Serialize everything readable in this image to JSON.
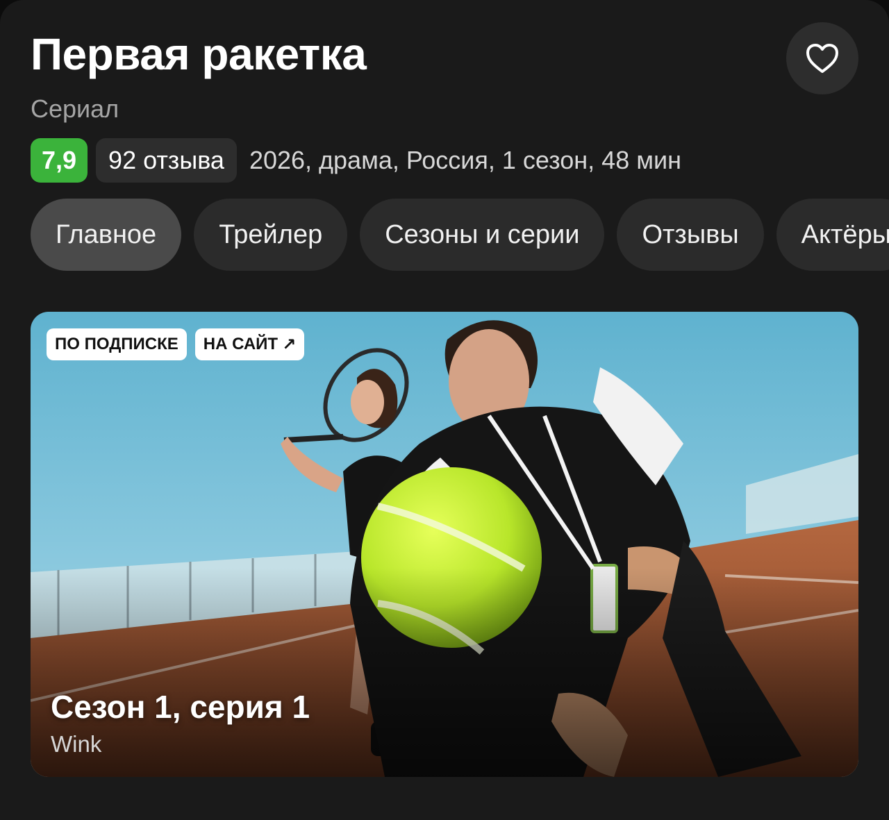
{
  "title": "Первая ракетка",
  "subtitle": "Сериал",
  "rating": "7,9",
  "reviews": "92 отзыва",
  "meta": "2026, драма, Россия, 1 сезон, 48 мин",
  "favorite_icon": "heart-icon",
  "tabs": [
    {
      "label": "Главное",
      "active": true
    },
    {
      "label": "Трейлер"
    },
    {
      "label": "Сезоны и серии"
    },
    {
      "label": "Отзывы"
    },
    {
      "label": "Актёры"
    }
  ],
  "hero": {
    "badge_subscription": "ПО ПОДПИСКЕ",
    "badge_site": "НА САЙТ",
    "badge_site_icon": "arrow-up-right-icon",
    "episode": "Сезон 1, серия 1",
    "provider": "Wink"
  },
  "colors": {
    "background": "#1a1a1a",
    "rating_green": "#3bb33b",
    "pill": "#2d2d2d",
    "tab_active": "#4a4a4a"
  }
}
